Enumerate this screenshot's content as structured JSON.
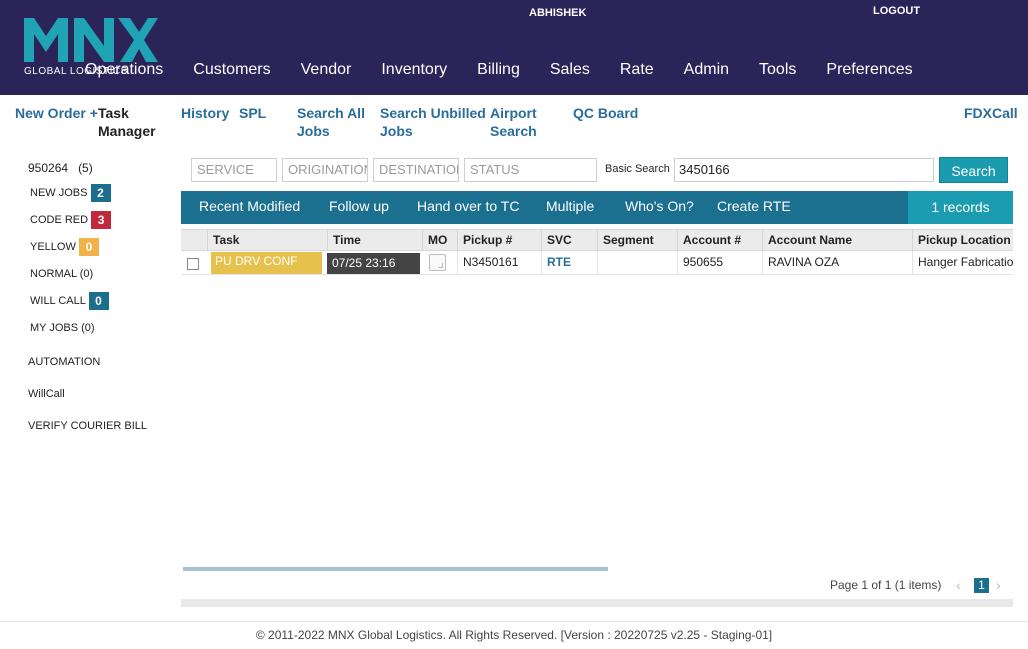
{
  "header": {
    "logo_text": "GLOBAL LOGISTICS",
    "user": "ABHISHEK",
    "logout": "LOGOUT",
    "nav": [
      "Operations",
      "Customers",
      "Vendor",
      "Inventory",
      "Billing",
      "Sales",
      "Rate",
      "Admin",
      "Tools",
      "Preferences"
    ]
  },
  "subnav": {
    "new_order": "New Order +",
    "task_manager_1": "Task",
    "task_manager_2": "Manager",
    "history": "History",
    "spl": "SPL",
    "search_all_1": "Search All",
    "search_all_2": "Jobs",
    "search_unbilled_1": "Search Unbilled",
    "search_unbilled_2": "Jobs",
    "airport_1": "Airport",
    "airport_2": "Search",
    "qc_board": "QC Board",
    "fdxcall": "FDXCall"
  },
  "sidebar": {
    "account": "950264",
    "account_count": "(5)",
    "new_jobs": "NEW JOBS",
    "new_jobs_count": "2",
    "code_red": "CODE RED",
    "code_red_count": "3",
    "yellow": "YELLOW",
    "yellow_count": "0",
    "normal": "NORMAL (0)",
    "will_call": "WILL CALL",
    "will_call_count": "0",
    "my_jobs": "MY JOBS (0)",
    "automation": "AUTOMATION",
    "willcall": "WillCall",
    "verify": "VERIFY COURIER BILL"
  },
  "filters": {
    "service": "SERVICE",
    "origination": "ORIGINATION",
    "destination": "DESTINATION",
    "status": "STATUS",
    "basic_search_label": "Basic Search",
    "basic_search_value": "3450166",
    "search_button": "Search"
  },
  "actions": {
    "recent_modified": "Recent Modified",
    "follow_up": "Follow up",
    "hand_over": "Hand over to TC",
    "multiple": "Multiple",
    "whos_on": "Who's On?",
    "create_rte": "Create RTE",
    "records": "1 records"
  },
  "table": {
    "headers": {
      "task": "Task",
      "time": "Time",
      "mo": "MO",
      "pickup": "Pickup #",
      "svc": "SVC",
      "segment": "Segment",
      "account": "Account #",
      "account_name": "Account Name",
      "pickup_location": "Pickup Location"
    },
    "rows": [
      {
        "task": "PU DRV CONF",
        "time": "07/25 23:16",
        "pickup": "N3450161",
        "svc": "RTE",
        "segment": "",
        "account": "950655",
        "account_name": "RAVINA OZA",
        "pickup_location": "Hanger Fabrication"
      }
    ]
  },
  "pager": {
    "info": "Page 1 of 1 (1 items)",
    "current": "1",
    "prev": "‹",
    "next": "›"
  },
  "footer": {
    "copyright": "© 2011-2022 MNX Global Logistics. All Rights Reserved. [Version : 20220725 v2.25 - Staging-01]"
  },
  "colors": {
    "header_bg": "#2a2459",
    "logo_teal": "#1fa3b5",
    "link_blue": "#2a6d9c",
    "action_bar": "#1b6f8f",
    "task_yellow": "#e6c24c",
    "badge_red": "#c0283c"
  }
}
